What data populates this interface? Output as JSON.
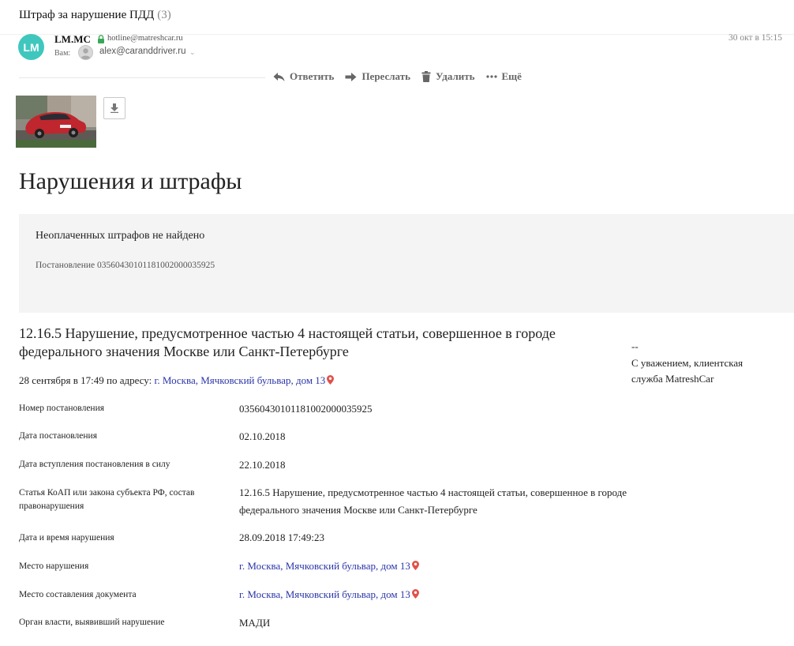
{
  "email": {
    "subject": "Штраф за нарушение ПДД",
    "thread_count": "(3)",
    "date": "30 окт в 15:15",
    "sender": {
      "avatar_initials": "LM",
      "name": "LM.MC",
      "email": "hotline@matreshcar.ru"
    },
    "recipient": {
      "label": "Вам:",
      "email": "alex@caranddriver.ru"
    }
  },
  "actions": {
    "reply": "Ответить",
    "forward": "Переслать",
    "delete": "Удалить",
    "more": "Ещё"
  },
  "content": {
    "title": "Нарушения и штрафы",
    "notice": {
      "title": "Неоплаченных штрафов не найдено",
      "resolution": "Постановление 03560430101181002000035925"
    },
    "violation": {
      "title": "12.16.5 Нарушение, предусмотренное частью 4 настоящей статьи, совершенное в городе федерального значения Москве или Санкт-Петербурге",
      "when_prefix": "28 сентября в 17:49 по адресу:",
      "address": "г. Москва, Мячковский бульвар, дом 13"
    },
    "details": {
      "resolution_number": {
        "label": "Номер постановления",
        "value": "03560430101181002000035925"
      },
      "resolution_date": {
        "label": "Дата постановления",
        "value": "02.10.2018"
      },
      "effective_date": {
        "label": "Дата вступления постановления в силу",
        "value": "22.10.2018"
      },
      "article": {
        "label": "Статья КоАП или закона субъекта РФ, состав правонарушения",
        "value": "12.16.5 Нарушение, предусмотренное частью 4 настоящей статьи, совершенное в городе федерального значения Москве или Санкт-Петербурге"
      },
      "violation_datetime": {
        "label": "Дата и время нарушения",
        "value": "28.09.2018 17:49:23"
      },
      "violation_place": {
        "label": "Место нарушения",
        "value": "г. Москва, Мячковский бульвар, дом 13"
      },
      "document_place": {
        "label": "Место составления документа",
        "value": "г. Москва, Мячковский бульвар, дом 13"
      },
      "authority": {
        "label": "Орган власти, выявивший нарушение",
        "value": "МАДИ"
      }
    },
    "signature": {
      "dash": "--",
      "text": "С уважением, клиентская служба MatreshCar"
    }
  },
  "colors": {
    "avatar": "#3fc7be",
    "link": "#2b36a8",
    "pin": "#e0524a",
    "lock": "#3aa757",
    "notice_background": "#f4f4f5"
  },
  "icons": [
    "lock-icon",
    "reply-icon",
    "forward-icon",
    "trash-icon",
    "more-icon",
    "download-icon",
    "map-pin-icon",
    "chevron-down-icon"
  ]
}
